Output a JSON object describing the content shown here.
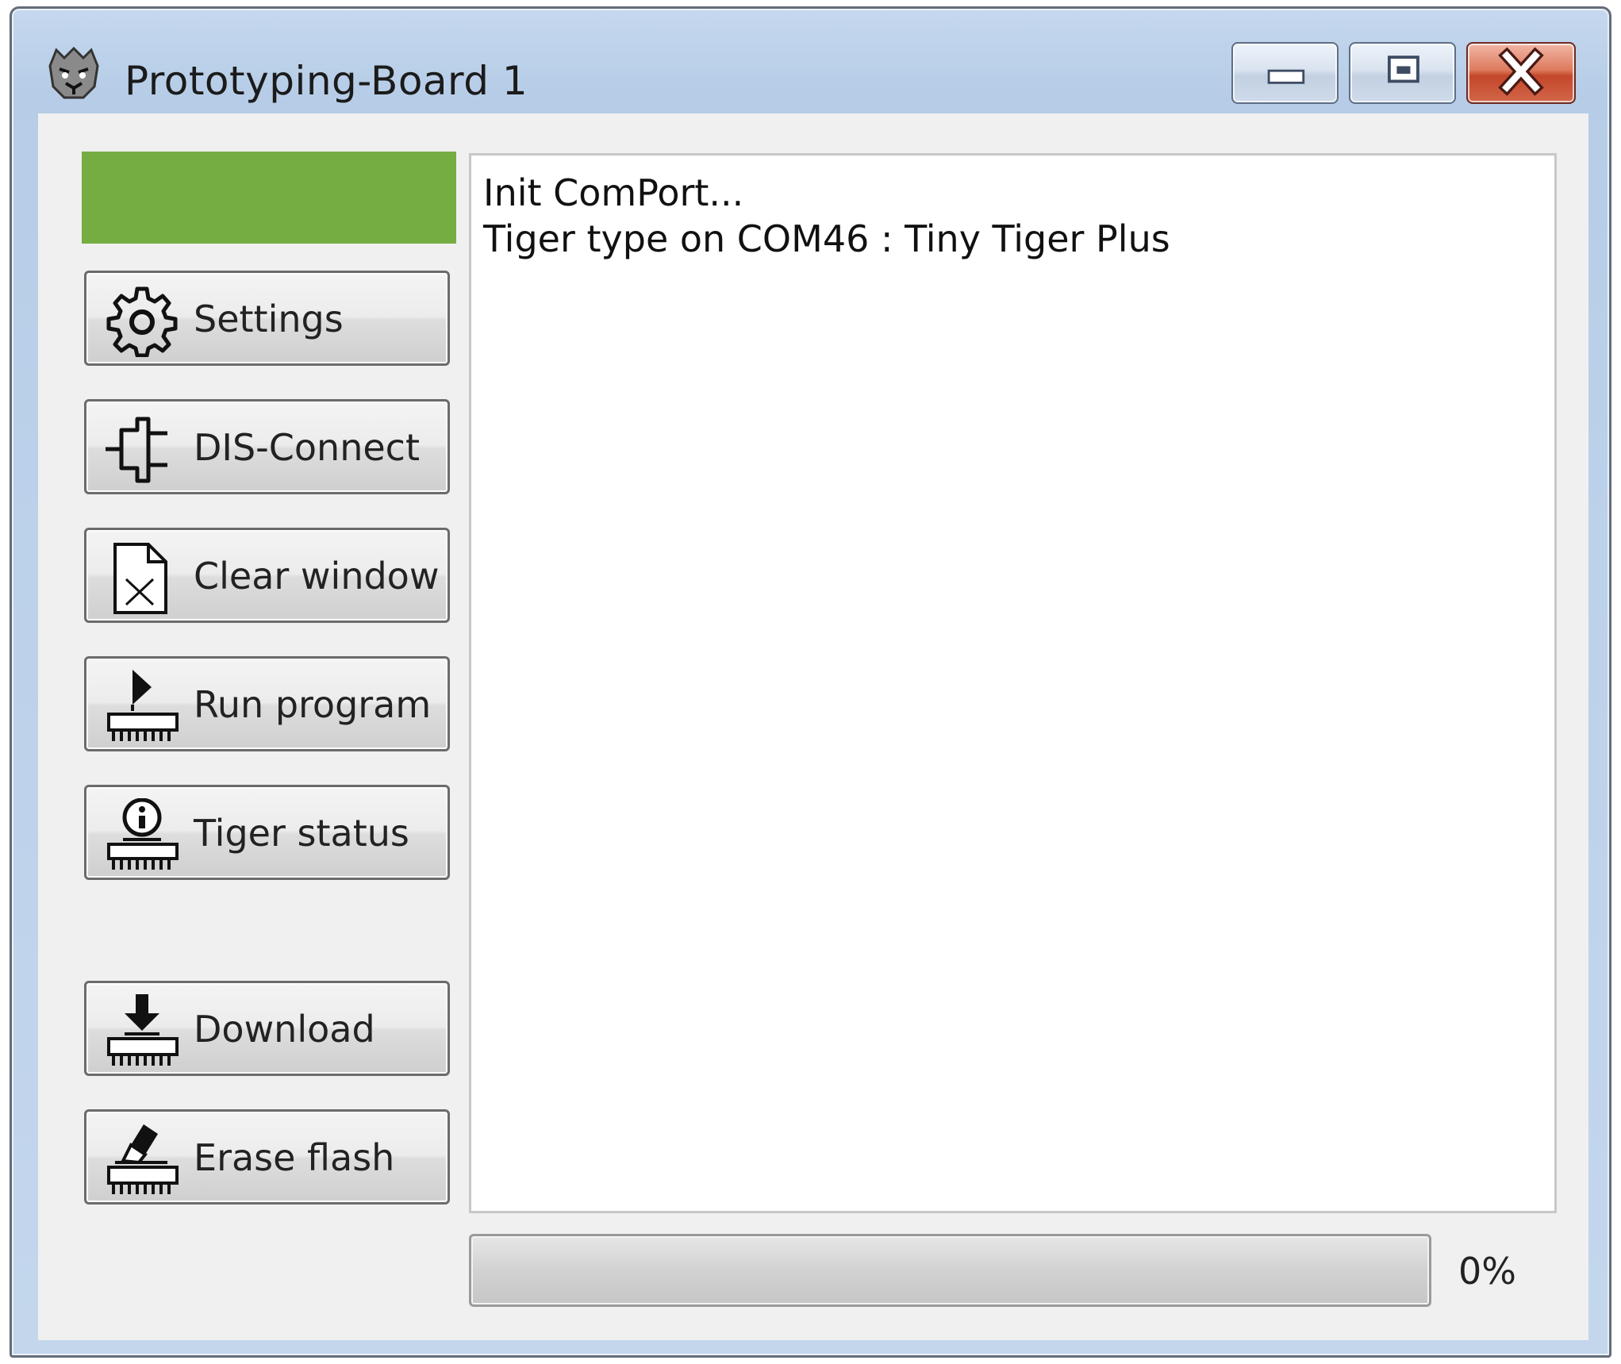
{
  "window": {
    "title": "Prototyping-Board 1",
    "app_icon": "tiger-head-icon",
    "controls": {
      "minimize": "minimize-icon",
      "maximize": "maximize-icon",
      "close": "close-icon"
    }
  },
  "status_indicator": {
    "color": "#76ad43"
  },
  "sidebar": {
    "buttons": [
      {
        "label": "Settings",
        "icon": "gear-icon"
      },
      {
        "label": "DIS-Connect",
        "icon": "plug-icon"
      },
      {
        "label": "Clear window",
        "icon": "clear-document-icon"
      },
      {
        "label": "Run program",
        "icon": "run-chip-icon"
      },
      {
        "label": "Tiger status",
        "icon": "info-chip-icon"
      },
      {
        "label": "Download",
        "icon": "download-chip-icon"
      },
      {
        "label": "Erase flash",
        "icon": "erase-chip-icon"
      }
    ]
  },
  "log": {
    "lines": [
      "Init ComPort...",
      "Tiger type on COM46 : Tiny Tiger Plus"
    ]
  },
  "progress": {
    "value": 0,
    "label": "0%"
  }
}
